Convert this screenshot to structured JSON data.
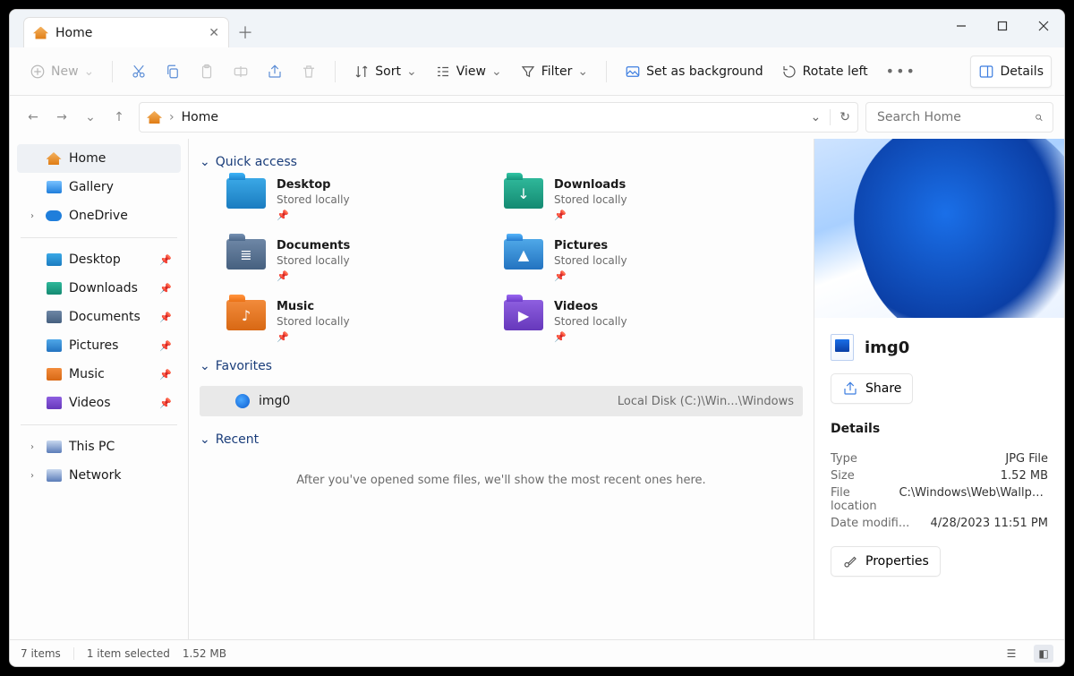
{
  "tab": {
    "title": "Home"
  },
  "toolbar": {
    "new": "New",
    "sort": "Sort",
    "view": "View",
    "filter": "Filter",
    "set_bg": "Set as background",
    "rotate_left": "Rotate left",
    "details": "Details"
  },
  "address": {
    "crumb": "Home"
  },
  "search": {
    "placeholder": "Search Home"
  },
  "sidebar": {
    "top": [
      {
        "label": "Home",
        "current": true
      },
      {
        "label": "Gallery"
      },
      {
        "label": "OneDrive",
        "expandable": true
      }
    ],
    "pinned": [
      {
        "label": "Desktop"
      },
      {
        "label": "Downloads"
      },
      {
        "label": "Documents"
      },
      {
        "label": "Pictures"
      },
      {
        "label": "Music"
      },
      {
        "label": "Videos"
      }
    ],
    "bottom": [
      {
        "label": "This PC",
        "expandable": true
      },
      {
        "label": "Network",
        "expandable": true
      }
    ]
  },
  "sections": {
    "quick_access": "Quick access",
    "favorites": "Favorites",
    "recent": "Recent"
  },
  "quick_access": [
    {
      "name": "Desktop",
      "sub": "Stored locally",
      "color": "blue",
      "glyph": ""
    },
    {
      "name": "Downloads",
      "sub": "Stored locally",
      "color": "teal",
      "glyph": "↓"
    },
    {
      "name": "Documents",
      "sub": "Stored locally",
      "color": "steel",
      "glyph": "≣"
    },
    {
      "name": "Pictures",
      "sub": "Stored locally",
      "color": "sky",
      "glyph": "▲"
    },
    {
      "name": "Music",
      "sub": "Stored locally",
      "color": "orange",
      "glyph": "♪"
    },
    {
      "name": "Videos",
      "sub": "Stored locally",
      "color": "purple",
      "glyph": "▶"
    }
  ],
  "favorites": [
    {
      "name": "img0",
      "location": "Local Disk (C:)\\Win...\\Windows"
    }
  ],
  "recent": {
    "empty_msg": "After you've opened some files, we'll show the most recent ones here."
  },
  "preview": {
    "filename": "img0",
    "share": "Share",
    "details_heading": "Details",
    "properties": "Properties",
    "meta": {
      "type_k": "Type",
      "type_v": "JPG File",
      "size_k": "Size",
      "size_v": "1.52 MB",
      "loc_k": "File location",
      "loc_v": "C:\\Windows\\Web\\Wallpa...",
      "date_k": "Date modifi...",
      "date_v": "4/28/2023 11:51 PM"
    }
  },
  "status": {
    "items": "7 items",
    "selected": "1 item selected",
    "size": "1.52 MB"
  }
}
